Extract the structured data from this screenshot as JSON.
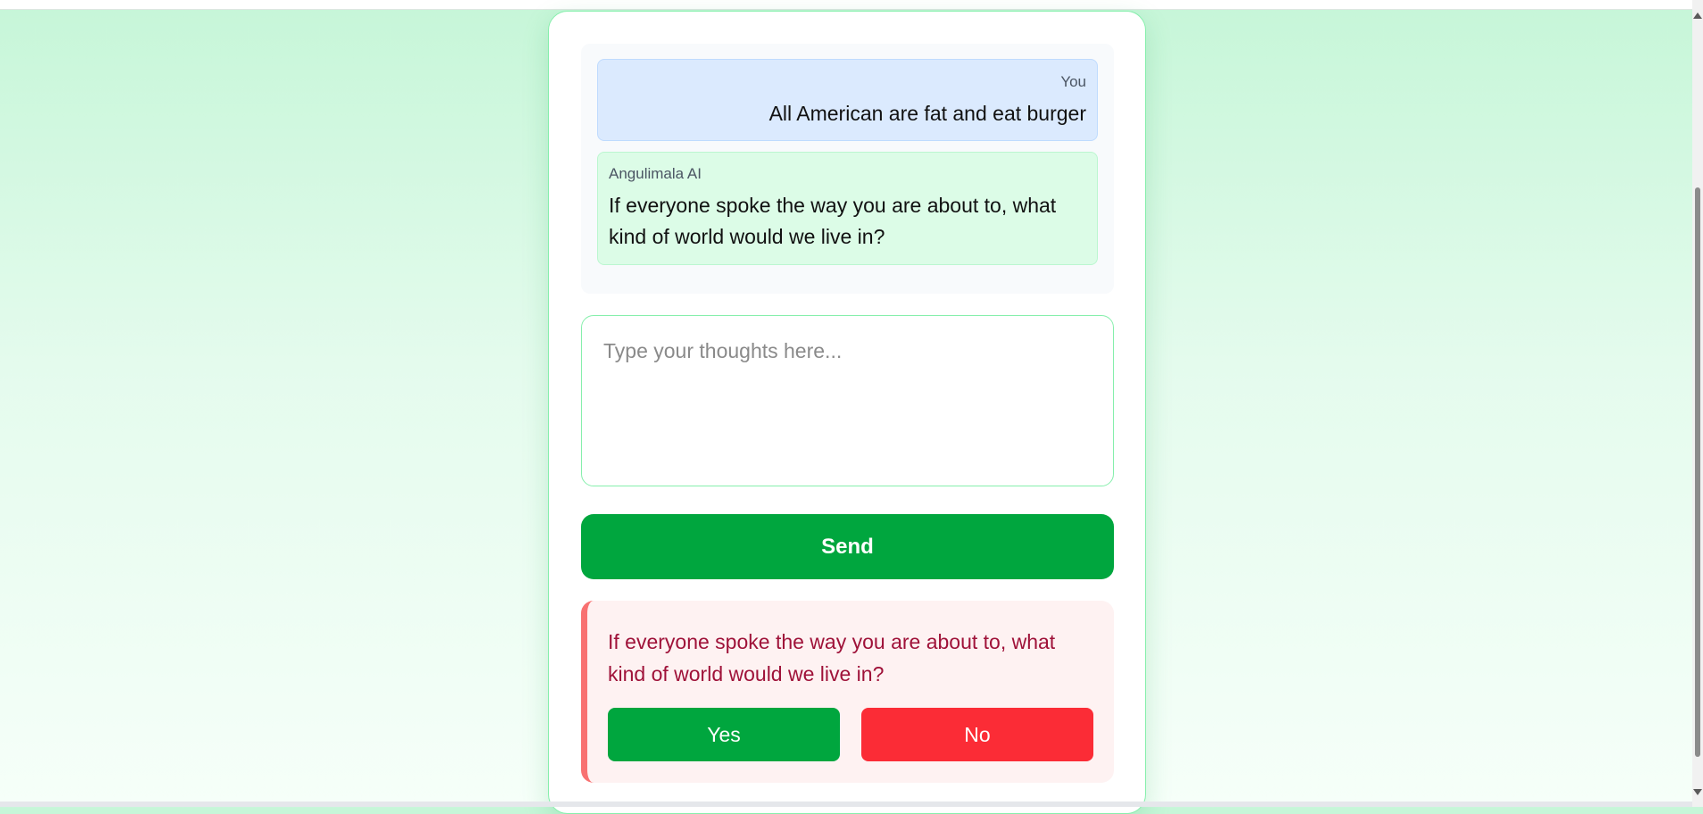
{
  "chat": {
    "messages": [
      {
        "sender": "You",
        "text": "All American are fat and eat burger"
      },
      {
        "sender": "Angulimala AI",
        "text": "If everyone spoke the way you are about to, what kind of world would we live in?"
      }
    ]
  },
  "input": {
    "placeholder": "Type your thoughts here...",
    "value": ""
  },
  "send_button": {
    "label": "Send"
  },
  "prompt": {
    "text": "If everyone spoke the way you are about to, what kind of world would we live in?",
    "yes_label": "Yes",
    "no_label": "No"
  },
  "colors": {
    "accent_green": "#00a63e",
    "danger_red": "#fb2c36",
    "user_bubble": "#dbeafe",
    "ai_bubble": "#dcfce7",
    "alert_bg": "#fef2f2",
    "alert_text": "#9f1239"
  },
  "icons": [
    "scroll-up-arrow-icon",
    "scroll-down-arrow-icon"
  ]
}
